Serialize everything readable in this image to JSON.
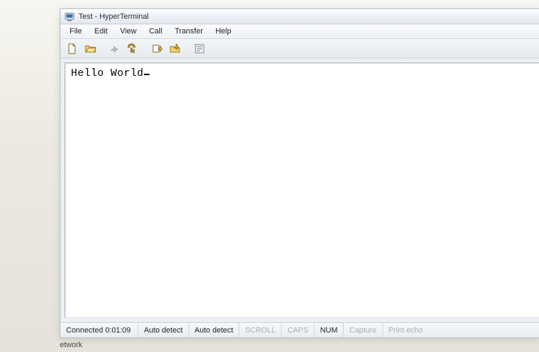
{
  "desktop": {
    "partial_label": "etwork"
  },
  "titlebar": {
    "title": "Test - HyperTerminal"
  },
  "menubar": {
    "items": [
      "File",
      "Edit",
      "View",
      "Call",
      "Transfer",
      "Help"
    ]
  },
  "toolbar": {
    "icons": [
      {
        "name": "new-file-icon",
        "enabled": true
      },
      {
        "name": "open-file-icon",
        "enabled": true
      },
      {
        "name": "connect-icon",
        "enabled": false
      },
      {
        "name": "disconnect-icon",
        "enabled": true
      },
      {
        "name": "send-icon",
        "enabled": true
      },
      {
        "name": "receive-icon",
        "enabled": true
      },
      {
        "name": "properties-icon",
        "enabled": true
      }
    ]
  },
  "terminal": {
    "content": "Hello World"
  },
  "statusbar": {
    "connected_label": "Connected",
    "elapsed": "0:01:09",
    "autodetect1": "Auto detect",
    "autodetect2": "Auto detect",
    "scroll": "SCROLL",
    "caps": "CAPS",
    "num": "NUM",
    "capture": "Capture",
    "printecho": "Print echo"
  }
}
